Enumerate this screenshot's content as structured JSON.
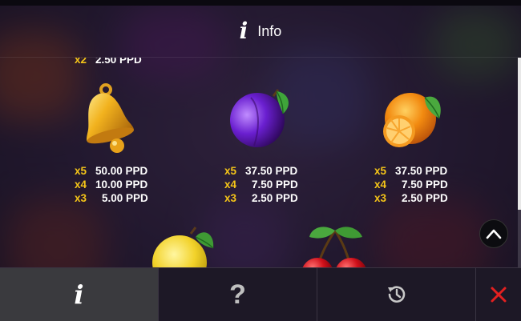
{
  "header": {
    "title": "Info",
    "info_icon": "info-icon"
  },
  "paytable": {
    "top_partial": {
      "mult": "x2",
      "value": "2.50 PPD"
    },
    "symbols": [
      {
        "name": "bell",
        "payouts": [
          {
            "mult": "x5",
            "value": "50.00 PPD"
          },
          {
            "mult": "x4",
            "value": "10.00 PPD"
          },
          {
            "mult": "x3",
            "value": "5.00 PPD"
          }
        ]
      },
      {
        "name": "plum",
        "payouts": [
          {
            "mult": "x5",
            "value": "37.50 PPD"
          },
          {
            "mult": "x4",
            "value": "7.50 PPD"
          },
          {
            "mult": "x3",
            "value": "2.50 PPD"
          }
        ]
      },
      {
        "name": "orange",
        "payouts": [
          {
            "mult": "x5",
            "value": "37.50 PPD"
          },
          {
            "mult": "x4",
            "value": "7.50 PPD"
          },
          {
            "mult": "x3",
            "value": "2.50 PPD"
          }
        ]
      }
    ],
    "partial_symbols": [
      "lemon",
      "cherries"
    ]
  },
  "nav": {
    "tabs": [
      "info",
      "help",
      "history",
      "close"
    ],
    "info_glyph": "i",
    "help_glyph": "?",
    "active": "info"
  },
  "colors": {
    "multiplier": "#f5c518",
    "close": "#e32020",
    "active_tab": "#3a3a3e"
  }
}
